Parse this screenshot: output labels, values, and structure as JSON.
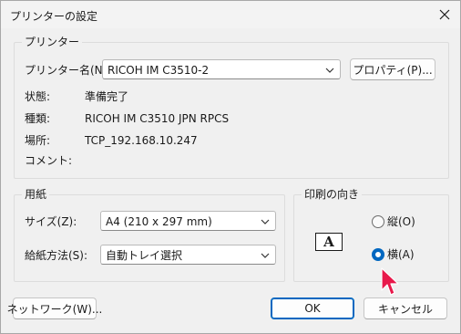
{
  "dialog": {
    "title": "プリンターの設定",
    "close_icon": "close-icon"
  },
  "printer": {
    "group_label": "プリンター",
    "name_label": "プリンター名(N):",
    "name_value": "RICOH IM C3510-2",
    "properties_button": "プロパティ(P)...",
    "status_label": "状態:",
    "status_value": "準備完了",
    "type_label": "種類:",
    "type_value": "RICOH IM C3510 JPN RPCS",
    "location_label": "場所:",
    "location_value": "TCP_192.168.10.247",
    "comment_label": "コメント:",
    "comment_value": ""
  },
  "paper": {
    "group_label": "用紙",
    "size_label": "サイズ(Z):",
    "size_value": "A4 (210 x 297 mm)",
    "source_label": "給紙方法(S):",
    "source_value": "自動トレイ選択"
  },
  "orientation": {
    "group_label": "印刷の向き",
    "preview_letter": "A",
    "portrait_label": "縦(O)",
    "landscape_label": "横(A)",
    "selected": "landscape"
  },
  "buttons": {
    "network": "ネットワーク(W)...",
    "ok": "OK",
    "cancel": "キャンセル"
  },
  "colors": {
    "accent": "#0067c0",
    "cursor": "#e8194b"
  }
}
